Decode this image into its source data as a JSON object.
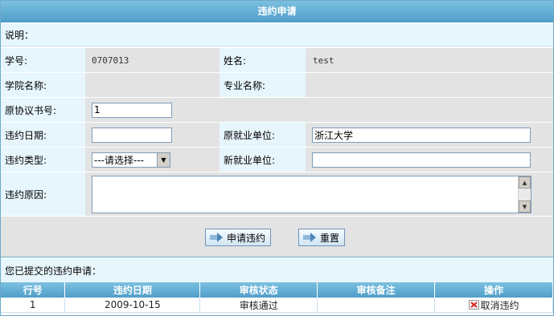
{
  "title": "违约申请",
  "note_label": "说明：",
  "form": {
    "student_no_label": "学号:",
    "student_no_value": "0707013",
    "name_label": "姓名:",
    "name_value": "test",
    "college_label": "学院名称:",
    "college_value": "",
    "major_label": "专业名称:",
    "major_value": "",
    "agreement_no_label": "原协议书号:",
    "agreement_no_value": "1",
    "breach_date_label": "违约日期:",
    "breach_date_value": "",
    "orig_employer_label": "原就业单位:",
    "orig_employer_value": "浙江大学",
    "breach_type_label": "违约类型:",
    "breach_type_selected": "---请选择---",
    "new_employer_label": "新就业单位:",
    "new_employer_value": "",
    "reason_label": "违约原因:",
    "reason_value": ""
  },
  "buttons": {
    "apply_label": "申请违约",
    "reset_label": "重置"
  },
  "submitted": {
    "title": "您已提交的违约申请：",
    "columns": [
      "行号",
      "违约日期",
      "审核状态",
      "审核备注",
      "操作"
    ],
    "rows": [
      {
        "index": "1",
        "date": "2009-10-15",
        "status": "审核通过",
        "remark": "",
        "action": "取消违约"
      }
    ]
  },
  "colors": {
    "header_blue": "#4f9ec9",
    "label_bg": "#e7f6fd",
    "value_bg": "#e3e3e3"
  }
}
